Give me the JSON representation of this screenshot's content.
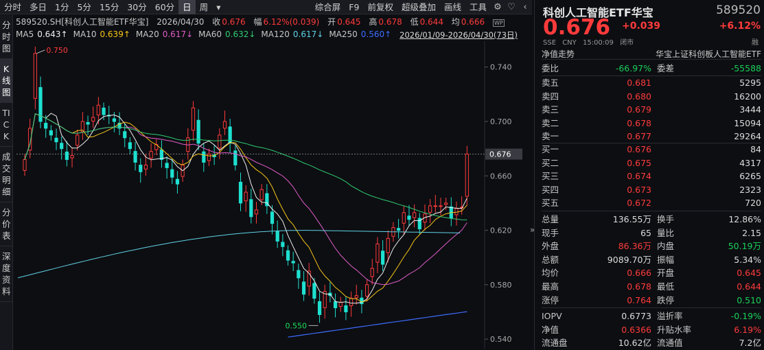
{
  "toolbar": {
    "items": [
      "分时",
      "多日",
      "1分",
      "5分",
      "15分",
      "30分",
      "60分",
      "日",
      "周"
    ],
    "active": "日",
    "more": "▾",
    "right": [
      "综合屏",
      "F9",
      "前复权",
      "超级叠加",
      "画线",
      "工具"
    ],
    "icons": [
      "gear-icon",
      "heart-icon",
      "back-icon"
    ]
  },
  "left_tabs": [
    "分时图",
    "K线图",
    "TICK",
    "成交明细",
    "分价表",
    "深度资料"
  ],
  "info": {
    "symbol": "589520.SH[科创人工智能ETF华宝]",
    "date": "2026/04/30",
    "close_label": "收",
    "close": "0.676",
    "amp_label": "幅",
    "amp": "6.12%(0.039)",
    "open_label": "开",
    "open": "0.645",
    "high_label": "高",
    "high": "0.678",
    "low_label": "低",
    "low": "0.644",
    "avg_label": "均",
    "avg": "0.666",
    "wp_badge": "WP"
  },
  "ma": [
    {
      "label": "MA5",
      "value": "0.643↑",
      "color": "#f0f0f0"
    },
    {
      "label": "MA10",
      "value": "0.639↑",
      "color": "#f5c518"
    },
    {
      "label": "MA20",
      "value": "0.617↓",
      "color": "#e05cc8"
    },
    {
      "label": "MA60",
      "value": "0.632↓",
      "color": "#2ecc71"
    },
    {
      "label": "MA120",
      "value": "0.617↓",
      "color": "#5fd3e6"
    },
    {
      "label": "MA250",
      "value": "0.560↑",
      "color": "#3d6cff"
    }
  ],
  "daterange": "2026/01/09-2026/04/30(73日)",
  "chart_data": {
    "type": "candlestick",
    "yaxis": {
      "ticks": [
        0.74,
        0.7,
        0.66,
        0.62,
        0.58,
        0.54
      ],
      "min": 0.533,
      "max": 0.757
    },
    "last_price_tag": "0.676",
    "annotations": {
      "high": "0.750",
      "low": "0.550"
    }
  },
  "right": {
    "title": "科创人工智能ETF华宝",
    "code": "589520",
    "price": "0.676",
    "change": "+0.039",
    "pct": "+6.12%",
    "meta": [
      "SSE",
      "CNY",
      "15:00:09",
      "闭市"
    ],
    "rong": "融",
    "nav_label": "净值走势",
    "index_label": "华宝上证科创板人工智能ETF",
    "weibi": {
      "l1": "委比",
      "v1": "-66.97%",
      "l2": "委差",
      "v2": "-55588"
    },
    "asks": [
      {
        "label": "卖五",
        "price": "0.681",
        "qty": "5295"
      },
      {
        "label": "卖四",
        "price": "0.680",
        "qty": "16200"
      },
      {
        "label": "卖三",
        "price": "0.679",
        "qty": "3444"
      },
      {
        "label": "卖二",
        "price": "0.678",
        "qty": "15094"
      },
      {
        "label": "卖一",
        "price": "0.677",
        "qty": "29264"
      }
    ],
    "bids": [
      {
        "label": "买一",
        "price": "0.676",
        "qty": "84"
      },
      {
        "label": "买二",
        "price": "0.675",
        "qty": "4317"
      },
      {
        "label": "买三",
        "price": "0.674",
        "qty": "6265"
      },
      {
        "label": "买四",
        "price": "0.673",
        "qty": "2323"
      },
      {
        "label": "买五",
        "price": "0.672",
        "qty": "720"
      }
    ],
    "stats": [
      {
        "l1": "总量",
        "v1": "136.55万",
        "c1": "white",
        "l2": "换手",
        "v2": "12.86%",
        "c2": "white"
      },
      {
        "l1": "现手",
        "v1": "65",
        "c1": "white",
        "l2": "量比",
        "v2": "2.15",
        "c2": "white"
      },
      {
        "l1": "外盘",
        "v1": "86.36万",
        "c1": "red",
        "l2": "内盘",
        "v2": "50.19万",
        "c2": "green"
      },
      {
        "l1": "总额",
        "v1": "9089.70万",
        "c1": "white",
        "l2": "振幅",
        "v2": "5.34%",
        "c2": "white"
      },
      {
        "l1": "均价",
        "v1": "0.666",
        "c1": "red",
        "l2": "开盘",
        "v2": "0.645",
        "c2": "red"
      },
      {
        "l1": "最高",
        "v1": "0.678",
        "c1": "red",
        "l2": "最低",
        "v2": "0.644",
        "c2": "red"
      },
      {
        "l1": "涨停",
        "v1": "0.764",
        "c1": "red",
        "l2": "跌停",
        "v2": "0.510",
        "c2": "green"
      }
    ],
    "stats2": [
      {
        "l1": "IOPV",
        "v1": "0.6773",
        "c1": "white",
        "l2": "溢折率",
        "v2": "-0.19%",
        "c2": "green"
      },
      {
        "l1": "净值",
        "v1": "0.6366",
        "c1": "red",
        "l2": "升贴水率",
        "v2": "6.19%",
        "c2": "red"
      },
      {
        "l1": "流通盘",
        "v1": "10.62亿",
        "c1": "white",
        "l2": "流通值",
        "v2": "7.2亿",
        "c2": "white"
      }
    ],
    "collapse": "»"
  }
}
